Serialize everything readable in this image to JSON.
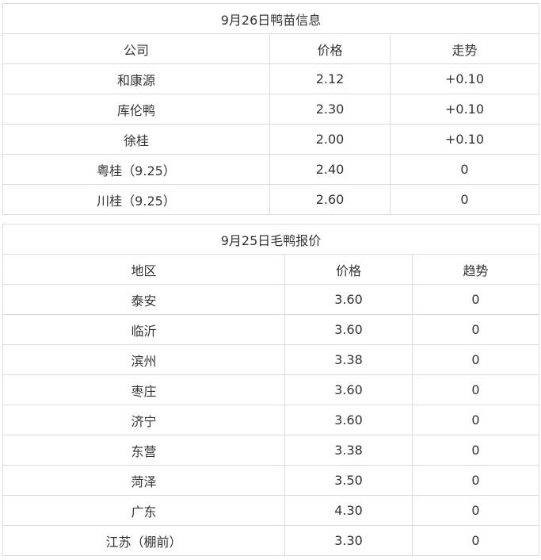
{
  "duckling_table": {
    "title": "9月26日鸭苗信息",
    "headers": [
      "公司",
      "价格",
      "走势"
    ],
    "rows": [
      [
        "和康源",
        "2.12",
        "+0.10"
      ],
      [
        "库伦鸭",
        "2.30",
        "+0.10"
      ],
      [
        "徐桂",
        "2.00",
        "+0.10"
      ],
      [
        "粤桂（9.25）",
        "2.40",
        "0"
      ],
      [
        "川桂（9.25）",
        "2.60",
        "0"
      ]
    ]
  },
  "duck_table": {
    "title": "9月25日毛鸭报价",
    "headers": [
      "地区",
      "价格",
      "趋势"
    ],
    "rows": [
      [
        "泰安",
        "3.60",
        "0"
      ],
      [
        "临沂",
        "3.60",
        "0"
      ],
      [
        "滨州",
        "3.38",
        "0"
      ],
      [
        "枣庄",
        "3.60",
        "0"
      ],
      [
        "济宁",
        "3.60",
        "0"
      ],
      [
        "东营",
        "3.38",
        "0"
      ],
      [
        "菏泽",
        "3.50",
        "0"
      ],
      [
        "广东",
        "4.30",
        "0"
      ],
      [
        "江苏（棚前）",
        "3.30",
        "0"
      ]
    ]
  },
  "colors": {
    "text": "#333333",
    "border": "#dcdcdc",
    "background": "#ffffff"
  }
}
